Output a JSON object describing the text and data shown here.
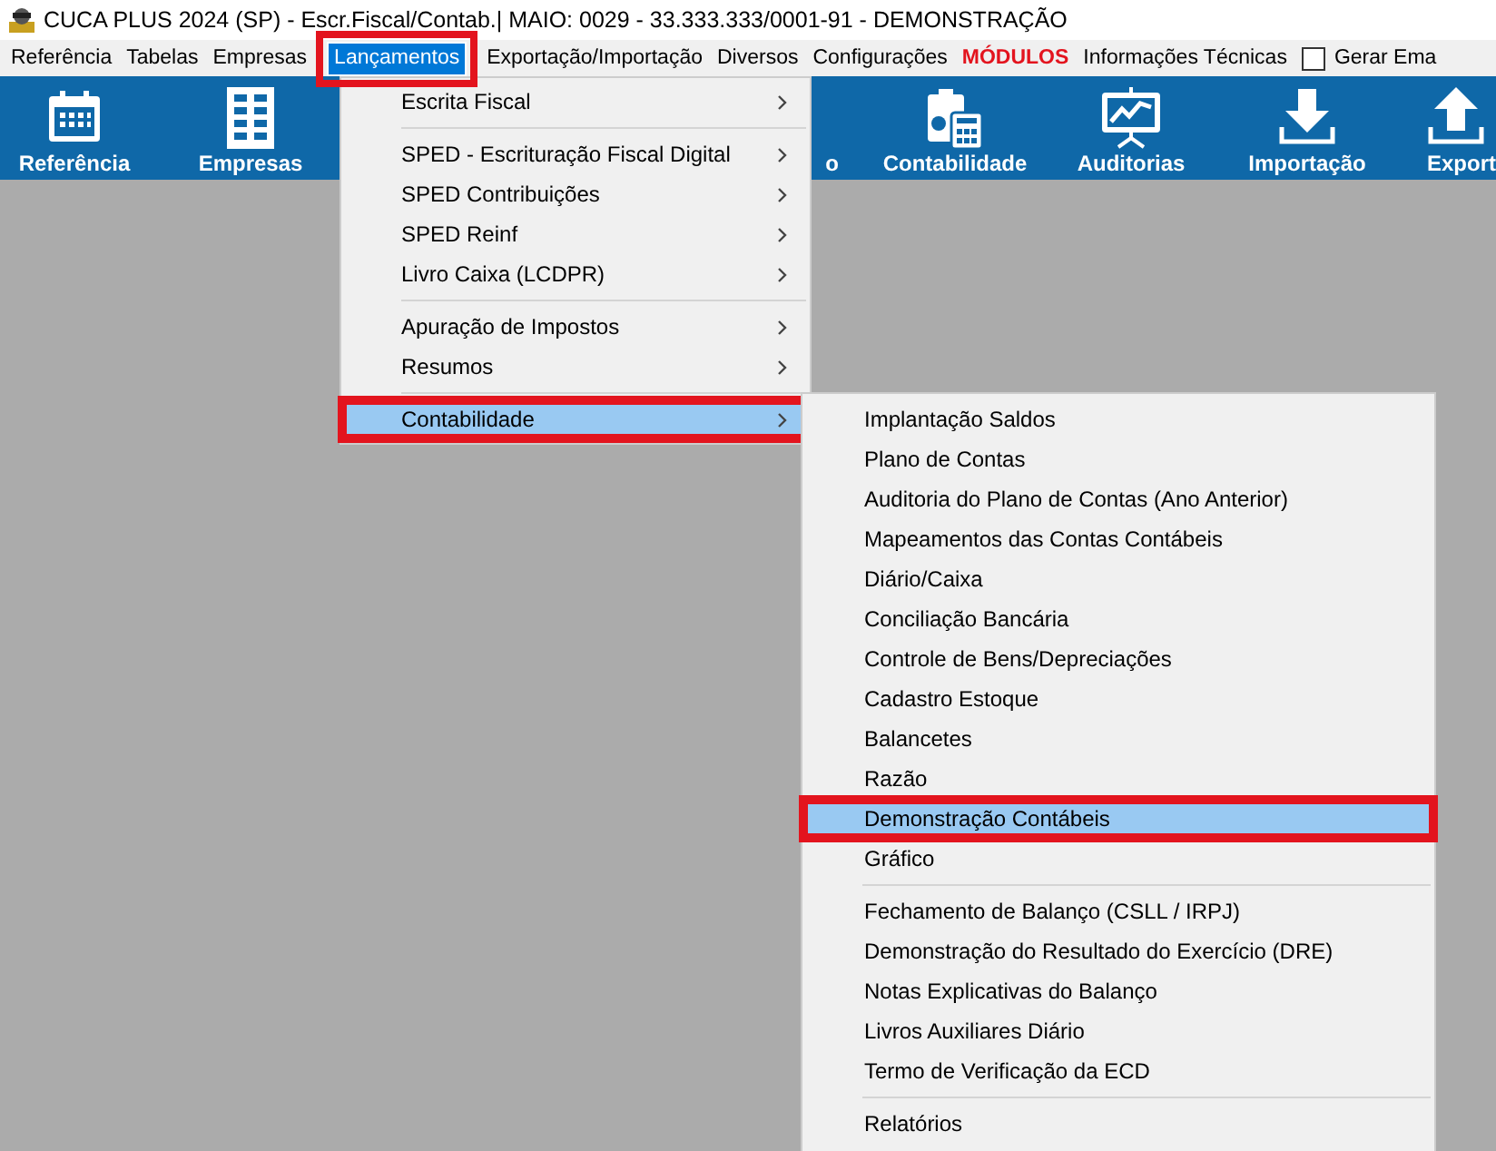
{
  "window": {
    "title": "CUCA PLUS 2024 (SP) - Escr.Fiscal/Contab.| MAIO: 0029 - 33.333.333/0001-91 - DEMONSTRAÇÃO"
  },
  "menubar": [
    {
      "kind": "menu",
      "label": "Referência",
      "selected": false,
      "highlighted": false
    },
    {
      "kind": "menu",
      "label": "Tabelas",
      "selected": false,
      "highlighted": false
    },
    {
      "kind": "menu",
      "label": "Empresas",
      "selected": false,
      "highlighted": false
    },
    {
      "kind": "menu",
      "label": "Lançamentos",
      "selected": true,
      "highlighted": true
    },
    {
      "kind": "menu",
      "label": "Exportação/Importação",
      "selected": false,
      "highlighted": false
    },
    {
      "kind": "menu",
      "label": "Diversos",
      "selected": false,
      "highlighted": false
    },
    {
      "kind": "menu",
      "label": "Configurações",
      "selected": false,
      "highlighted": false
    },
    {
      "kind": "module",
      "label": "MÓDULOS",
      "selected": false,
      "highlighted": false
    },
    {
      "kind": "menu",
      "label": "Informações Técnicas",
      "selected": false,
      "highlighted": false
    },
    {
      "kind": "checkbox",
      "label": "Gerar Ema",
      "checked": false
    }
  ],
  "toolbar": [
    {
      "kind": "calendar",
      "label": "Referência"
    },
    {
      "kind": "building",
      "label": "Empresas"
    },
    {
      "kind": "hidden",
      "label": "o"
    },
    {
      "kind": "accounting",
      "label": "Contabilidade"
    },
    {
      "kind": "chart",
      "label": "Auditorias"
    },
    {
      "kind": "download",
      "label": "Importação"
    },
    {
      "kind": "upload",
      "label": "Export"
    }
  ],
  "menu": {
    "groups": [
      [
        {
          "label": "Escrita Fiscal",
          "has_submenu": true,
          "selected": false,
          "highlighted": false
        }
      ],
      [
        {
          "label": "SPED - Escrituração Fiscal Digital",
          "has_submenu": true,
          "selected": false,
          "highlighted": false
        },
        {
          "label": "SPED Contribuições",
          "has_submenu": true,
          "selected": false,
          "highlighted": false
        },
        {
          "label": "SPED Reinf",
          "has_submenu": true,
          "selected": false,
          "highlighted": false
        },
        {
          "label": "Livro Caixa (LCDPR)",
          "has_submenu": true,
          "selected": false,
          "highlighted": false
        }
      ],
      [
        {
          "label": "Apuração de Impostos",
          "has_submenu": true,
          "selected": false,
          "highlighted": false
        },
        {
          "label": "Resumos",
          "has_submenu": true,
          "selected": false,
          "highlighted": false
        }
      ],
      [
        {
          "label": "Contabilidade",
          "has_submenu": true,
          "selected": true,
          "highlighted": true
        }
      ]
    ]
  },
  "submenu": {
    "groups": [
      [
        {
          "label": "Implantação Saldos",
          "selected": false,
          "highlighted": false
        },
        {
          "label": "Plano de Contas",
          "selected": false,
          "highlighted": false
        },
        {
          "label": "Auditoria do Plano de Contas (Ano Anterior)",
          "selected": false,
          "highlighted": false
        },
        {
          "label": "Mapeamentos das Contas Contábeis",
          "selected": false,
          "highlighted": false
        },
        {
          "label": "Diário/Caixa",
          "selected": false,
          "highlighted": false
        },
        {
          "label": "Conciliação Bancária",
          "selected": false,
          "highlighted": false
        },
        {
          "label": "Controle de Bens/Depreciações",
          "selected": false,
          "highlighted": false
        },
        {
          "label": "Cadastro Estoque",
          "selected": false,
          "highlighted": false
        },
        {
          "label": "Balancetes",
          "selected": false,
          "highlighted": false
        },
        {
          "label": "Razão",
          "selected": false,
          "highlighted": false
        },
        {
          "label": "Demonstração Contábeis",
          "selected": true,
          "highlighted": true
        },
        {
          "label": "Gráfico",
          "selected": false,
          "highlighted": false
        }
      ],
      [
        {
          "label": "Fechamento de Balanço (CSLL / IRPJ)",
          "selected": false,
          "highlighted": false
        },
        {
          "label": "Demonstração do Resultado do Exercício (DRE)",
          "selected": false,
          "highlighted": false
        },
        {
          "label": "Notas Explicativas do Balanço",
          "selected": false,
          "highlighted": false
        },
        {
          "label": "Livros Auxiliares Diário",
          "selected": false,
          "highlighted": false
        },
        {
          "label": "Termo de Verificação da ECD",
          "selected": false,
          "highlighted": false
        }
      ],
      [
        {
          "label": "Relatórios",
          "selected": false,
          "highlighted": false
        }
      ]
    ]
  }
}
